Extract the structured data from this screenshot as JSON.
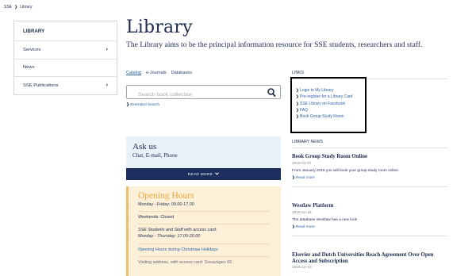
{
  "breadcrumb": {
    "home": "SSE",
    "current": "Library"
  },
  "sidebar": {
    "items": [
      {
        "label": "LIBRARY",
        "chevron": false
      },
      {
        "label": "Services",
        "chevron": true
      },
      {
        "label": "News",
        "chevron": false
      },
      {
        "label": "SSE Publications",
        "chevron": true
      }
    ]
  },
  "main": {
    "title": "Library",
    "intro": "The Library aims to be the principal information resource for SSE students, researchers and staff.",
    "tabs": [
      "Catalog",
      "e-Journals",
      "Databases"
    ],
    "search_placeholder": "Search book collection",
    "extended_search": "Extended Search"
  },
  "links": {
    "heading": "LINKS",
    "items": [
      "Login to My Library",
      "Pre-register for a Library Card",
      "SSE Library on Facebook",
      "FAQ",
      "Book Group Study Room"
    ]
  },
  "ask": {
    "title": "Ask us",
    "subtitle": "Chat, E-mail, Phone",
    "read_more": "READ MORE"
  },
  "hours": {
    "title": "Opening Hours",
    "weekdays": "Monday - Friday: 09.00-17.00",
    "weekends": "Weekends: Closed",
    "card_line1": "SSE Students and Staff with access card:",
    "card_line2": "Monday - Thursday: 17.00-20.00",
    "christmas": "Opening Hours during Christmas Holidays",
    "cut": "Visiting address, with access card: Sveavägen 65"
  },
  "library_news": {
    "heading": "LIBRARY NEWS",
    "items": [
      {
        "title": "Book Group Study Room Online",
        "date": "2016-01-07",
        "summary": "From January 2016 you will book your group study room online.",
        "more": "Read more"
      },
      {
        "title": "Westlaw Platform",
        "date": "2015-12-18",
        "summary": "The database Westlaw has a new look",
        "more": "Read more"
      },
      {
        "title": "Elsevier and Dutch Universities Reach Agreement Over Open Access and Subscription",
        "date": "2015-12-10"
      }
    ]
  }
}
